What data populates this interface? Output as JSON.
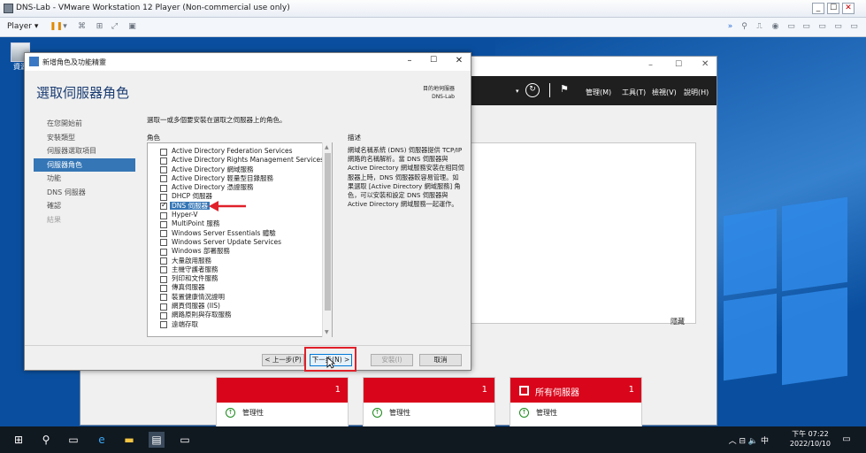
{
  "vmware": {
    "title": "DNS-Lab - VMware Workstation 12 Player (Non-commercial use only)",
    "player_label": "Player ▾",
    "min": "_",
    "max": "☐",
    "close": "✕"
  },
  "desktop": {
    "recycle_label": "資源"
  },
  "server_manager": {
    "menus": [
      "管理(M)",
      "工具(T)",
      "檢視(V)",
      "說明(H)"
    ],
    "hide_link": "隱藏",
    "tiles": [
      {
        "title": "",
        "count": "1",
        "status": "管理性"
      },
      {
        "title": "",
        "count": "1",
        "status": "管理性"
      },
      {
        "title": "所有伺服器",
        "count": "1",
        "status": "管理性"
      }
    ]
  },
  "wizard": {
    "title": "新增角色及功能精靈",
    "heading": "選取伺服器角色",
    "dest_label": "目的地伺服器",
    "dest_server": "DNS-Lab",
    "nav": [
      {
        "label": "在您開始前",
        "state": "normal"
      },
      {
        "label": "安裝類型",
        "state": "normal"
      },
      {
        "label": "伺服器選取項目",
        "state": "normal"
      },
      {
        "label": "伺服器角色",
        "state": "active"
      },
      {
        "label": "功能",
        "state": "normal"
      },
      {
        "label": "DNS 伺服器",
        "state": "normal"
      },
      {
        "label": "確認",
        "state": "normal"
      },
      {
        "label": "結果",
        "state": "disabled"
      }
    ],
    "instruction": "選取一或多個要安裝在選取之伺服器上的角色。",
    "roles_label": "角色",
    "description_label": "描述",
    "roles": [
      {
        "label": "Active Directory Federation Services",
        "checked": false
      },
      {
        "label": "Active Directory Rights Management Services",
        "checked": false
      },
      {
        "label": "Active Directory 網域服務",
        "checked": false
      },
      {
        "label": "Active Directory 輕量型目錄服務",
        "checked": false
      },
      {
        "label": "Active Directory 憑證服務",
        "checked": false
      },
      {
        "label": "DHCP 伺服器",
        "checked": false
      },
      {
        "label": "DNS 伺服器",
        "checked": true,
        "selected": true
      },
      {
        "label": "Hyper-V",
        "checked": false
      },
      {
        "label": "MultiPoint 服務",
        "checked": false
      },
      {
        "label": "Windows Server Essentials 體驗",
        "checked": false
      },
      {
        "label": "Windows Server Update Services",
        "checked": false
      },
      {
        "label": "Windows 部署服務",
        "checked": false
      },
      {
        "label": "大量啟用服務",
        "checked": false
      },
      {
        "label": "主機守護者服務",
        "checked": false
      },
      {
        "label": "列印和文件服務",
        "checked": false
      },
      {
        "label": "傳真伺服器",
        "checked": false
      },
      {
        "label": "裝置健康情況證明",
        "checked": false
      },
      {
        "label": "網頁伺服器 (IIS)",
        "checked": false
      },
      {
        "label": "網路原則與存取服務",
        "checked": false
      },
      {
        "label": "遠端存取",
        "checked": false
      }
    ],
    "description": "網域名稱系統 (DNS) 伺服器提供 TCP/IP 網路的名稱解析。當 DNS 伺服器與 Active Directory 網域服務安裝在相同伺服器上時，DNS 伺服器較容易管理。如果選取 [Active Directory 網域服務] 角色，可以安裝和設定 DNS 伺服器與 Active Directory 網域服務一起運作。",
    "buttons": {
      "prev": "< 上一步(P)",
      "next": "下一步(N) >",
      "install": "安裝(I)",
      "cancel": "取消"
    }
  },
  "taskbar": {
    "time": "下午 07:22",
    "date": "2022/10/10",
    "ime": "中"
  }
}
